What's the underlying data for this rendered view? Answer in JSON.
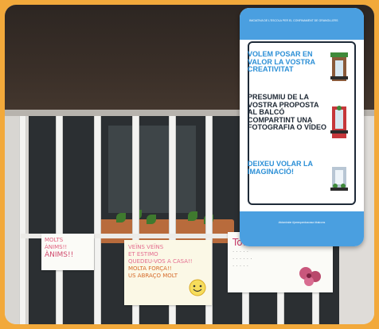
{
  "poster": {
    "header_text": "INICIATIVA DE L'ESCOLA PER EL CONFINAMENT DE GRANOLLERS",
    "line_volem": "VOLEM POSAR EN VALOR LA VOSTRA CREATIVITAT",
    "line_presumiu": "PRESUMIU DE LA VOSTRA PROPOSTA AL BALCÓ COMPARTINT UNA FOTOGRAFIA O VÍDEO",
    "line_deixeu": "DEIXEU VOLAR LA IMAGINACIÓ!",
    "footer_text": "#totanirabe #jomequedoacasa #balcons",
    "accent_color": "#2b8fd6",
    "banner_color": "#4a9fe0",
    "icons": [
      "balcony-plants-icon",
      "balcony-door-icon",
      "balcony-flowers-icon"
    ]
  },
  "notes": {
    "note_left_lines": [
      "MOLTS",
      "ÀNIMS!!",
      "ÀNIMS!!"
    ],
    "note_middle_lines": [
      "VEÏNS VEÏNS",
      "ET ESTIMO",
      "QUEDEU-VOS A CASA!!",
      "MOLTA FORÇA!!",
      "US ABRAÇO MOLT"
    ],
    "note_right_lines": [
      "Tot anirà Bé",
      "· · · · ·",
      "· · · · · ·",
      "· · · · ·"
    ]
  },
  "frame_color": "#f2a93b"
}
